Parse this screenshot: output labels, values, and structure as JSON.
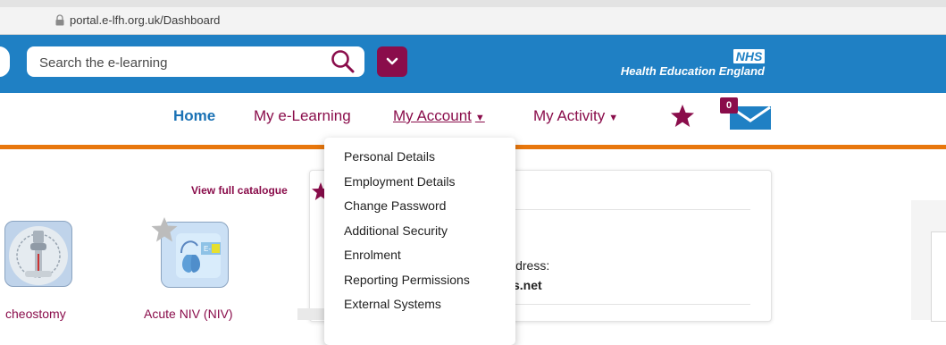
{
  "browser": {
    "url": "portal.e-lfh.org.uk/Dashboard"
  },
  "header": {
    "search_placeholder": "Search the e-learning",
    "nhs_label": "NHS",
    "org_name": "Health Education England"
  },
  "nav": {
    "home": "Home",
    "my_elearning": "My e-Learning",
    "my_account": "My Account",
    "my_activity": "My Activity",
    "mail_count": "0"
  },
  "account_menu": {
    "items": [
      "Personal Details",
      "Employment Details",
      "Change Password",
      "Additional Security",
      "Enrolment",
      "Reporting Permissions",
      "External Systems"
    ]
  },
  "content": {
    "catalogue_link": "View full catalogue",
    "courses": [
      {
        "label": "cheostomy"
      },
      {
        "label": "Acute NIV (NIV)"
      }
    ],
    "address_label": "ldress:",
    "address_value": "s.net"
  },
  "colors": {
    "header_blue": "#1f80c4",
    "brand_maroon": "#8a0d4b",
    "orange_rule": "#e8770d",
    "home_blue": "#1b72b5"
  }
}
